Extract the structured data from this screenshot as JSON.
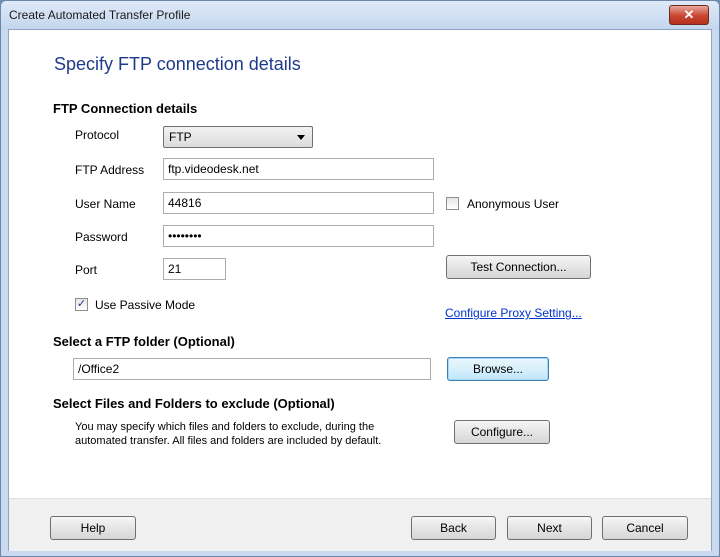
{
  "window": {
    "title": "Create Automated Transfer Profile",
    "close_glyph": "✕"
  },
  "page": {
    "header": "Specify FTP connection details"
  },
  "ftp_details": {
    "section_label": "FTP Connection details",
    "protocol": {
      "label": "Protocol",
      "selected": "FTP"
    },
    "address": {
      "label": "FTP Address",
      "value": "ftp.videodesk.net"
    },
    "username": {
      "label": "User Name",
      "value": "44816"
    },
    "password": {
      "label": "Password",
      "value": "••••••••"
    },
    "port": {
      "label": "Port",
      "value": "21"
    },
    "anonymous": {
      "label": "Anonymous User",
      "checked": false
    },
    "passive": {
      "label": "Use Passive Mode",
      "checked": true,
      "check_glyph": "✓"
    },
    "test_button": "Test Connection...",
    "proxy_link": "Configure Proxy Setting..."
  },
  "folder": {
    "section_label": "Select a FTP folder (Optional)",
    "value": "/Office2",
    "browse_button": "Browse..."
  },
  "exclude": {
    "section_label": "Select Files and Folders to exclude (Optional)",
    "description": "You may specify which files and folders to exclude, during the automated transfer. All files and folders are included by default.",
    "configure_button": "Configure..."
  },
  "footer": {
    "help": "Help",
    "back": "Back",
    "next": "Next",
    "cancel": "Cancel"
  }
}
